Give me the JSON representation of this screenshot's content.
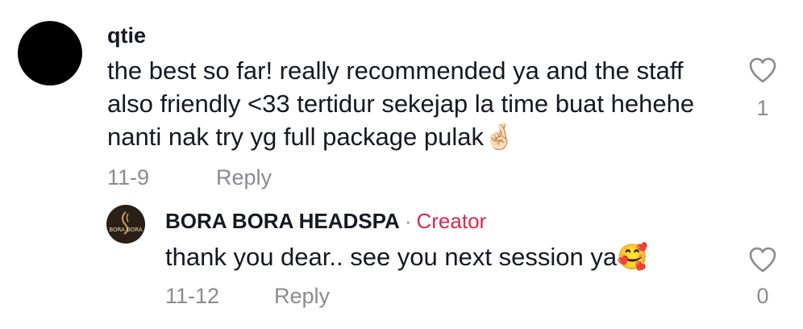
{
  "comments": [
    {
      "username": "qtie",
      "text": "the best so far! really recommended ya and the staff also friendly <33 tertidur sekejap la time buat hehehe nanti nak try yg full package pulak🤞🏻",
      "date": "11-9",
      "reply_label": "Reply",
      "like_count": "1",
      "avatar_icon": "avatar-black-circle",
      "like_icon": "heart-outline-icon"
    }
  ],
  "reply": {
    "username": "BORA BORA HEADSPA",
    "separator": "·",
    "badge": "Creator",
    "avatar_text": "BORA BORA",
    "text": "thank you dear.. see you next session ya🥰",
    "date": "11-12",
    "reply_label": "Reply",
    "like_count": "0",
    "like_icon": "heart-outline-icon"
  },
  "colors": {
    "text": "#161823",
    "muted": "#8a8b91",
    "creator": "#e0264f"
  }
}
